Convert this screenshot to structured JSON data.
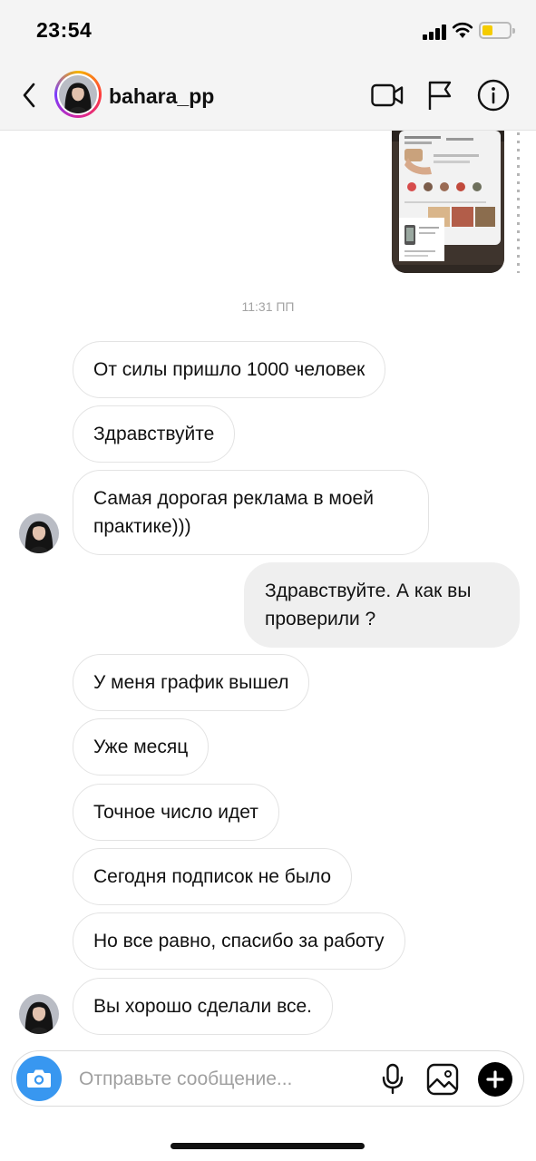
{
  "status_bar": {
    "time": "23:54",
    "battery_level": 0.35,
    "battery_color": "#f5cc00"
  },
  "header": {
    "username": "bahara_pp",
    "icons": [
      "back-icon",
      "video-call-icon",
      "flag-icon",
      "info-icon"
    ]
  },
  "thread": {
    "shared_image": {
      "kind": "screenshot-thumbnail"
    },
    "timestamp": "11:31 ПП",
    "messages": [
      {
        "from": "them",
        "text": "От силы пришло 1000 человек"
      },
      {
        "from": "them",
        "text": "Здравствуйте"
      },
      {
        "from": "them",
        "text": "Самая дорогая реклама в моей практике)))"
      },
      {
        "from": "me",
        "text": "Здравствуйте. А как вы проверили ?"
      },
      {
        "from": "them",
        "text": "У меня график вышел"
      },
      {
        "from": "them",
        "text": "Уже месяц"
      },
      {
        "from": "them",
        "text": "Точное число идет"
      },
      {
        "from": "them",
        "text": "Сегодня подписок не было"
      },
      {
        "from": "them",
        "text": "Но все равно, спасибо за работу"
      },
      {
        "from": "them",
        "text": "Вы хорошо сделали все."
      }
    ]
  },
  "composer": {
    "placeholder": "Отправьте сообщение...",
    "value": "",
    "icons": [
      "camera-icon",
      "microphone-icon",
      "gallery-icon",
      "plus-icon"
    ]
  },
  "colors": {
    "accent": "#3897f0",
    "incoming_border": "#e3e3e3",
    "outgoing_bg": "#efefef",
    "timestamp": "#a3a3a3"
  }
}
